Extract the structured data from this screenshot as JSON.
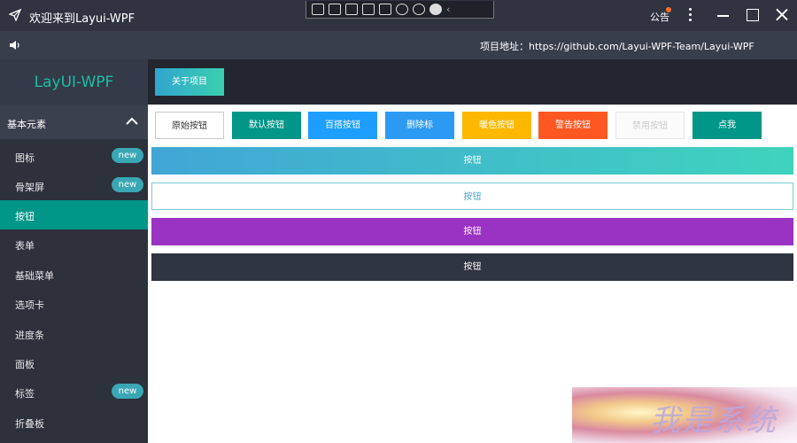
{
  "window": {
    "title": "欢迎来到Layui-WPF",
    "notice_label": "公告",
    "app_icon": "send-icon",
    "debug_tools": [
      "select-element-icon",
      "display-layout-icon",
      "pointer-icon",
      "bounding-box-icon",
      "track-focus-icon",
      "binding-icon",
      "accessibility-icon",
      "check-icon"
    ]
  },
  "subbar": {
    "speaker_icon": "speaker-icon",
    "address_text": "项目地址：https://github.com/Layui-WPF-Team/Layui-WPF"
  },
  "sidebar": {
    "logo": "LayUI-WPF",
    "group_label": "基本元素",
    "items": [
      {
        "label": "图标",
        "badge": "new"
      },
      {
        "label": "骨架屏",
        "badge": "new"
      },
      {
        "label": "按钮",
        "active": true
      },
      {
        "label": "表单"
      },
      {
        "label": "基础菜单"
      },
      {
        "label": "选项卡"
      },
      {
        "label": "进度条"
      },
      {
        "label": "面板"
      },
      {
        "label": "标签",
        "badge": "new"
      },
      {
        "label": "折叠板"
      }
    ]
  },
  "topbar": {
    "about_label": "关于项目"
  },
  "buttons": {
    "original": "原始按钮",
    "default": "默认按钮",
    "normal": "百搭按钮",
    "blue": "删除标",
    "warm": "暖色按钮",
    "danger": "警告按钮",
    "disabled": "禁用按钮",
    "click": "点我"
  },
  "wide_buttons": [
    "按钮",
    "按钮",
    "按钮",
    "按钮"
  ],
  "watermark": "我是系统",
  "colors": {
    "accent": "#009688",
    "titlebar": "#2f3440",
    "sidebar": "#2c313c",
    "badge": "#3aa7b5",
    "normal": "#1e9fff",
    "warm": "#ffb800",
    "danger": "#ff5722",
    "purple": "#9a33c4"
  }
}
